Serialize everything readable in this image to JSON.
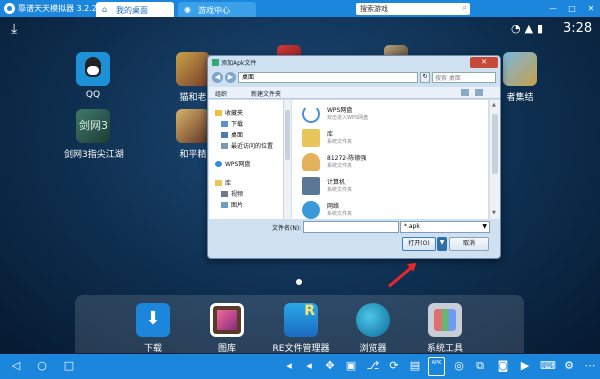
{
  "titlebar": {
    "app_title": "靠谱天天模拟器 3.2.2",
    "tabs": [
      {
        "label": "我的桌面"
      },
      {
        "label": "游戏中心"
      }
    ],
    "search_placeholder": "搜索游戏",
    "window_buttons": [
      "—",
      "□",
      "✕"
    ]
  },
  "status": {
    "time": "3:28"
  },
  "desktop_apps": [
    {
      "label": "QQ"
    },
    {
      "label": "剑网3指尖江湖"
    },
    {
      "label": "猫和老"
    },
    {
      "label": "和平精"
    },
    {
      "label": "者集结"
    }
  ],
  "dock": [
    {
      "label": "下载"
    },
    {
      "label": "图库"
    },
    {
      "label": "RE文件管理器"
    },
    {
      "label": "浏览器"
    },
    {
      "label": "系统工具"
    }
  ],
  "dialog": {
    "title": "添加Apk文件",
    "address": "桌面",
    "search_placeholder": "搜索 桌面",
    "commands": [
      "组织",
      "新建文件夹"
    ],
    "nav": [
      "收藏夹",
      "下载",
      "桌面",
      "最近访问的位置",
      "WPS网盘",
      "库",
      "视频",
      "图片"
    ],
    "files": [
      {
        "name": "WPS网盘",
        "desc": "双击进入WPS网盘"
      },
      {
        "name": "库",
        "desc": "系统文件夹"
      },
      {
        "name": "81272-陈德强",
        "desc": "系统文件夹"
      },
      {
        "name": "计算机",
        "desc": "系统文件夹"
      },
      {
        "name": "网络",
        "desc": "系统文件夹"
      }
    ],
    "filename_label": "文件名(N):",
    "filename_value": "",
    "filetype": "*.apk",
    "open_label": "打开(O)",
    "cancel_label": "取消"
  },
  "toolbar": {
    "apk_label": "APK"
  },
  "colors": {
    "brand_blue": "#1b86dc",
    "annotation_red": "#e8282d"
  }
}
